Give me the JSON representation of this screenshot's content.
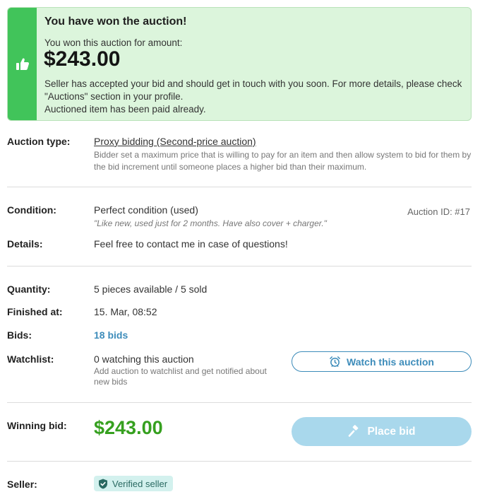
{
  "banner": {
    "title": "You have won the auction!",
    "subtitle": "You won this auction for amount:",
    "amount": "$243.00",
    "message_line1": "Seller has accepted your bid and should get in touch with you soon. For more details, please check \"Auctions\" section in your profile.",
    "message_line2": "Auctioned item has been paid already.",
    "icon": "thumbs-up-icon",
    "accent_color": "#41c45a"
  },
  "auction_type": {
    "label": "Auction type:",
    "value": "Proxy bidding (Second-price auction)",
    "description": "Bidder set a maximum price that is willing to pay for an item and then allow system to bid for them by the bid increment until someone places a higher bid than their maximum."
  },
  "condition": {
    "label": "Condition:",
    "value": "Perfect condition (used)",
    "note": "\"Like new, used just for 2 months. Have also cover + charger.\""
  },
  "auction_id": "Auction ID: #17",
  "details": {
    "label": "Details:",
    "value": "Feel free to contact me in case of questions!"
  },
  "quantity": {
    "label": "Quantity:",
    "value": "5 pieces available / 5 sold"
  },
  "finished_at": {
    "label": "Finished at:",
    "value": "15. Mar, 08:52"
  },
  "bids": {
    "label": "Bids:",
    "value": "18 bids",
    "color": "#3d8cba"
  },
  "watchlist": {
    "label": "Watchlist:",
    "value": "0 watching this auction",
    "note": "Add auction to watchlist and get notified about new bids",
    "button_label": "Watch this auction",
    "button_icon": "alarm-clock-icon"
  },
  "winning_bid": {
    "label": "Winning bid:",
    "amount": "$243.00",
    "amount_color": "#36a01f",
    "button_label": "Place bid",
    "button_icon": "gavel-icon",
    "button_color": "#a9d8ec"
  },
  "seller": {
    "label": "Seller:",
    "badge": "Verified seller",
    "badge_icon": "shield-check-icon"
  }
}
